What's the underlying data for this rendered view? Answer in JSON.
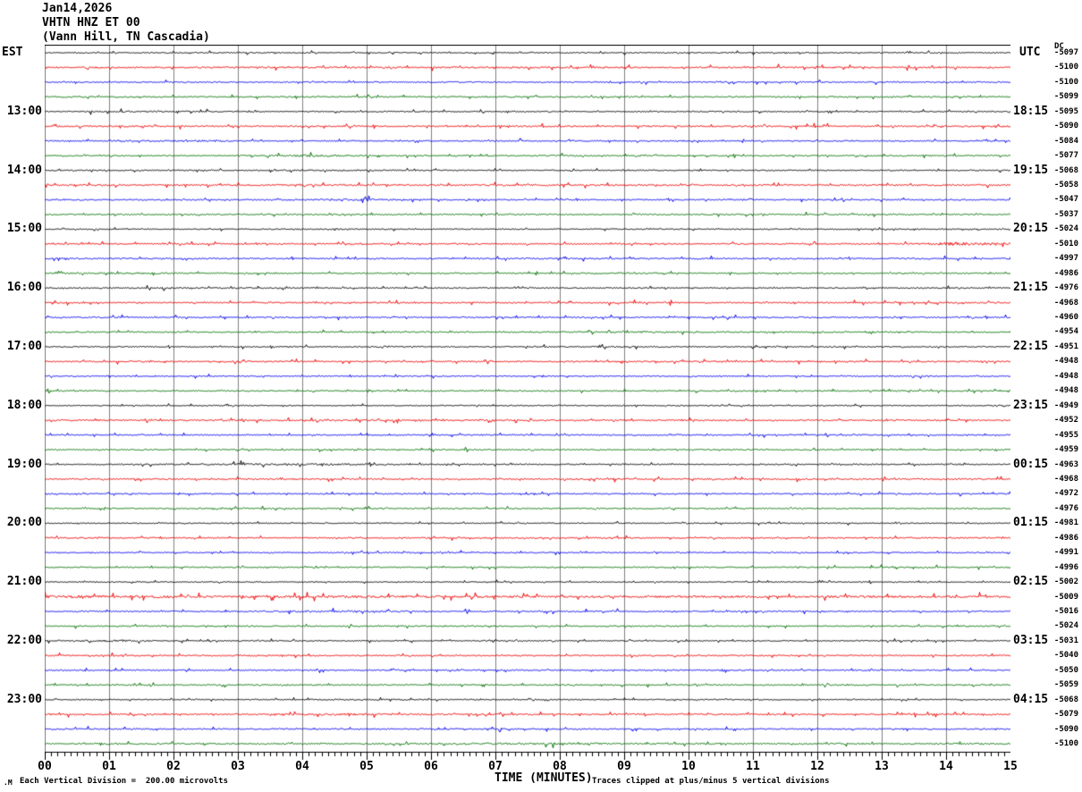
{
  "title": {
    "date": "Jan14,2026",
    "station": "VHTN HNZ ET 00",
    "location": "(Vann Hill, TN Cascadia)"
  },
  "header": {
    "left_tz": "EST",
    "right_tz": "UTC",
    "dc_header": "DC"
  },
  "footer": {
    "corner_mark": ".M",
    "scale_note": "Each Vertical Division =  200.00 microvolts",
    "x_label": "TIME (MINUTES)",
    "clip_note": "Traces clipped at plus/minus 5 vertical divisions"
  },
  "colors": {
    "black": "#000000",
    "red": "#f00000",
    "blue": "#0000f0",
    "green": "#007000",
    "grid": "#808080",
    "axis": "#000000",
    "background": "#ffffff"
  },
  "chart_data": {
    "type": "line",
    "subtype": "helicorder-seismogram",
    "x_axis": {
      "label": "TIME (MINUTES)",
      "min": 0,
      "max": 15,
      "tick_labels": [
        "00",
        "01",
        "02",
        "03",
        "04",
        "05",
        "06",
        "07",
        "08",
        "09",
        "10",
        "11",
        "12",
        "13",
        "14",
        "15"
      ],
      "minor_ticks_per_major": 10,
      "grid": "vertical-gray-per-minute"
    },
    "trace_color_cycle": [
      "black",
      "red",
      "blue",
      "green"
    ],
    "minutes_per_row": 15,
    "rows": [
      {
        "est": "",
        "utc": "",
        "dc": "-5097",
        "color": "black",
        "amp": 0.9,
        "events": []
      },
      {
        "est": "",
        "utc": "",
        "dc": "-5100",
        "color": "red",
        "amp": 1.3,
        "events": []
      },
      {
        "est": "",
        "utc": "",
        "dc": "-5100",
        "color": "blue",
        "amp": 1.0,
        "events": []
      },
      {
        "est": "",
        "utc": "",
        "dc": "-5099",
        "color": "green",
        "amp": 1.1,
        "events": []
      },
      {
        "est": "13:00",
        "utc": "18:15",
        "dc": "-5095",
        "color": "black",
        "amp": 0.9,
        "events": [
          {
            "m": 1.3,
            "w": 1.2,
            "a": 1.5
          }
        ]
      },
      {
        "est": "",
        "utc": "",
        "dc": "-5090",
        "color": "red",
        "amp": 1.2,
        "events": []
      },
      {
        "est": "",
        "utc": "",
        "dc": "-5084",
        "color": "blue",
        "amp": 1.0,
        "events": [
          {
            "m": 2.3,
            "w": 0.5,
            "a": 2.0
          }
        ]
      },
      {
        "est": "",
        "utc": "",
        "dc": "-5077",
        "color": "green",
        "amp": 1.1,
        "events": [
          {
            "m": 4.2,
            "w": 0.5,
            "a": 1.8
          }
        ]
      },
      {
        "est": "14:00",
        "utc": "19:15",
        "dc": "-5068",
        "color": "black",
        "amp": 0.9,
        "events": [
          {
            "m": 4.3,
            "w": 0.9,
            "a": 1.6
          }
        ]
      },
      {
        "est": "",
        "utc": "",
        "dc": "-5058",
        "color": "red",
        "amp": 1.3,
        "events": []
      },
      {
        "est": "",
        "utc": "",
        "dc": "-5047",
        "color": "blue",
        "amp": 1.0,
        "events": [
          {
            "m": 4.9,
            "w": 0.6,
            "a": 2.0
          }
        ]
      },
      {
        "est": "",
        "utc": "",
        "dc": "-5037",
        "color": "green",
        "amp": 1.1,
        "events": []
      },
      {
        "est": "15:00",
        "utc": "20:15",
        "dc": "-5024",
        "color": "black",
        "amp": 0.8,
        "events": [
          {
            "m": 4.3,
            "w": 0.8,
            "a": 1.5
          }
        ]
      },
      {
        "est": "",
        "utc": "",
        "dc": "-5010",
        "color": "red",
        "amp": 1.1,
        "events": [
          {
            "m": 14.3,
            "w": 0.5,
            "a": 3.2
          }
        ]
      },
      {
        "est": "",
        "utc": "",
        "dc": "-4997",
        "color": "blue",
        "amp": 1.2,
        "events": []
      },
      {
        "est": "",
        "utc": "",
        "dc": "-4986",
        "color": "green",
        "amp": 1.0,
        "events": [
          {
            "m": 1.5,
            "w": 0.8,
            "a": 1.5
          }
        ]
      },
      {
        "est": "16:00",
        "utc": "21:15",
        "dc": "-4976",
        "color": "black",
        "amp": 0.9,
        "events": [
          {
            "m": 2.0,
            "w": 2.0,
            "a": 1.3
          }
        ]
      },
      {
        "est": "",
        "utc": "",
        "dc": "-4968",
        "color": "red",
        "amp": 1.1,
        "events": []
      },
      {
        "est": "",
        "utc": "",
        "dc": "-4960",
        "color": "blue",
        "amp": 1.1,
        "events": []
      },
      {
        "est": "",
        "utc": "",
        "dc": "-4954",
        "color": "green",
        "amp": 1.0,
        "events": [
          {
            "m": 8.8,
            "w": 0.9,
            "a": 1.5
          }
        ]
      },
      {
        "est": "17:00",
        "utc": "22:15",
        "dc": "-4951",
        "color": "black",
        "amp": 0.9,
        "events": [
          {
            "m": 5.4,
            "w": 0.4,
            "a": 1.8
          },
          {
            "m": 8.7,
            "w": 1.4,
            "a": 1.3
          }
        ]
      },
      {
        "est": "",
        "utc": "",
        "dc": "-4948",
        "color": "red",
        "amp": 1.1,
        "events": []
      },
      {
        "est": "",
        "utc": "",
        "dc": "-4948",
        "color": "blue",
        "amp": 0.9,
        "events": []
      },
      {
        "est": "",
        "utc": "",
        "dc": "-4948",
        "color": "green",
        "amp": 1.0,
        "events": []
      },
      {
        "est": "18:00",
        "utc": "23:15",
        "dc": "-4949",
        "color": "black",
        "amp": 0.8,
        "events": []
      },
      {
        "est": "",
        "utc": "",
        "dc": "-4952",
        "color": "red",
        "amp": 1.2,
        "events": []
      },
      {
        "est": "",
        "utc": "",
        "dc": "-4955",
        "color": "blue",
        "amp": 1.0,
        "events": []
      },
      {
        "est": "",
        "utc": "",
        "dc": "-4959",
        "color": "green",
        "amp": 1.0,
        "events": []
      },
      {
        "est": "19:00",
        "utc": "00:15",
        "dc": "-4963",
        "color": "black",
        "amp": 0.9,
        "events": [
          {
            "m": 3.0,
            "w": 1.1,
            "a": 1.8
          },
          {
            "m": 4.6,
            "w": 0.7,
            "a": 1.6
          }
        ]
      },
      {
        "est": "",
        "utc": "",
        "dc": "-4968",
        "color": "red",
        "amp": 1.2,
        "events": []
      },
      {
        "est": "",
        "utc": "",
        "dc": "-4972",
        "color": "blue",
        "amp": 1.0,
        "events": []
      },
      {
        "est": "",
        "utc": "",
        "dc": "-4976",
        "color": "green",
        "amp": 1.0,
        "events": []
      },
      {
        "est": "20:00",
        "utc": "01:15",
        "dc": "-4981",
        "color": "black",
        "amp": 0.8,
        "events": []
      },
      {
        "est": "",
        "utc": "",
        "dc": "-4986",
        "color": "red",
        "amp": 1.1,
        "events": []
      },
      {
        "est": "",
        "utc": "",
        "dc": "-4991",
        "color": "blue",
        "amp": 0.9,
        "events": [
          {
            "m": 5.5,
            "w": 0.7,
            "a": 1.4
          }
        ]
      },
      {
        "est": "",
        "utc": "",
        "dc": "-4996",
        "color": "green",
        "amp": 1.0,
        "events": []
      },
      {
        "est": "21:00",
        "utc": "02:15",
        "dc": "-5002",
        "color": "black",
        "amp": 0.8,
        "events": []
      },
      {
        "est": "",
        "utc": "",
        "dc": "-5009",
        "color": "red",
        "amp": 1.8,
        "events": [
          {
            "m": 0.6,
            "w": 1.0,
            "a": 1.3
          },
          {
            "m": 5.0,
            "w": 1.2,
            "a": 1.2
          }
        ]
      },
      {
        "est": "",
        "utc": "",
        "dc": "-5016",
        "color": "blue",
        "amp": 1.1,
        "events": [
          {
            "m": 4.2,
            "w": 0.8,
            "a": 1.5
          }
        ]
      },
      {
        "est": "",
        "utc": "",
        "dc": "-5024",
        "color": "green",
        "amp": 1.0,
        "events": []
      },
      {
        "est": "22:00",
        "utc": "03:15",
        "dc": "-5031",
        "color": "black",
        "amp": 0.9,
        "events": [
          {
            "m": 0.9,
            "w": 0.9,
            "a": 1.9
          }
        ]
      },
      {
        "est": "",
        "utc": "",
        "dc": "-5040",
        "color": "red",
        "amp": 1.1,
        "events": []
      },
      {
        "est": "",
        "utc": "",
        "dc": "-5050",
        "color": "blue",
        "amp": 1.0,
        "events": []
      },
      {
        "est": "",
        "utc": "",
        "dc": "-5059",
        "color": "green",
        "amp": 1.0,
        "events": []
      },
      {
        "est": "23:00",
        "utc": "04:15",
        "dc": "-5068",
        "color": "black",
        "amp": 0.8,
        "events": [
          {
            "m": 5.0,
            "w": 1.0,
            "a": 1.4
          }
        ]
      },
      {
        "est": "",
        "utc": "",
        "dc": "-5079",
        "color": "red",
        "amp": 1.2,
        "events": [
          {
            "m": 4.7,
            "w": 0.7,
            "a": 1.5
          }
        ]
      },
      {
        "est": "",
        "utc": "",
        "dc": "-5090",
        "color": "blue",
        "amp": 1.1,
        "events": []
      },
      {
        "est": "",
        "utc": "",
        "dc": "-5100",
        "color": "green",
        "amp": 1.3,
        "events": [
          {
            "m": 7.5,
            "w": 1.4,
            "a": 1.25
          }
        ]
      }
    ]
  }
}
